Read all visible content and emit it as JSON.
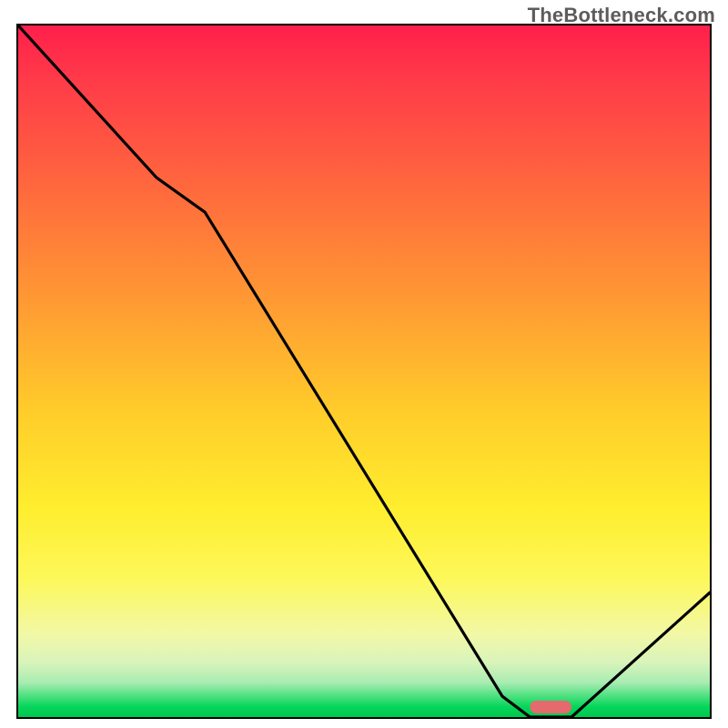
{
  "watermark": "TheBottleneck.com",
  "chart_data": {
    "type": "line",
    "title": "",
    "xlabel": "",
    "ylabel": "",
    "xlim": [
      0,
      100
    ],
    "ylim": [
      0,
      100
    ],
    "series": [
      {
        "name": "bottleneck-curve",
        "x": [
          0,
          20,
          27,
          70,
          74,
          80,
          100
        ],
        "values": [
          100,
          78,
          73,
          3,
          0,
          0,
          18
        ]
      }
    ],
    "minimum_region_x": [
      74,
      80
    ],
    "gradient_stops": [
      {
        "pos": 0.0,
        "color": "#ff1f4b"
      },
      {
        "pos": 0.24,
        "color": "#ff6a3d"
      },
      {
        "pos": 0.56,
        "color": "#ffcd2a"
      },
      {
        "pos": 0.8,
        "color": "#fdf85a"
      },
      {
        "pos": 0.95,
        "color": "#a9ecb2"
      },
      {
        "pos": 1.0,
        "color": "#00c74f"
      }
    ]
  }
}
